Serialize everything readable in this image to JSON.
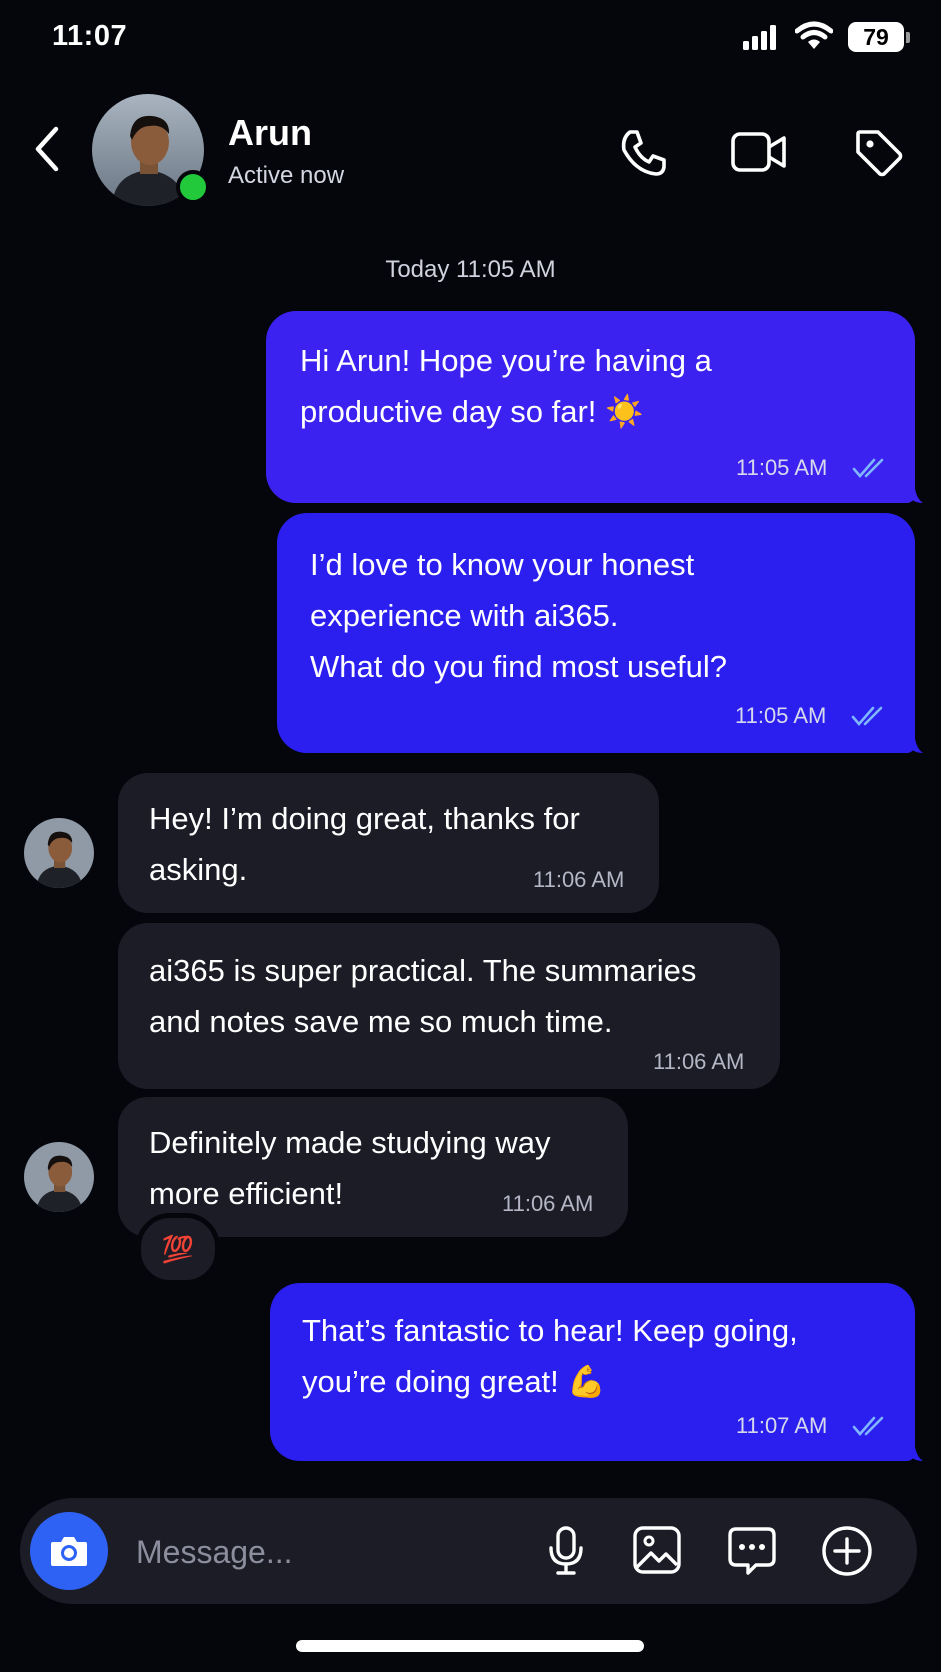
{
  "status_bar": {
    "time": "11:07",
    "battery": "79"
  },
  "header": {
    "contact_name": "Arun",
    "presence": "Active now",
    "online_color": "#22c93a"
  },
  "conversation": {
    "date_separator": "Today 11:05 AM",
    "messages": [
      {
        "direction": "outgoing",
        "text": "Hi Arun! Hope you’re having a\nproductive day so far! ☀️",
        "time": "11:05 AM",
        "read": true
      },
      {
        "direction": "outgoing",
        "text": "I’d love to know your honest\nexperience with ai365.\nWhat do you find most useful?",
        "time": "11:05 AM",
        "read": true
      },
      {
        "direction": "incoming",
        "text": "Hey! I’m doing great, thanks for\nasking.",
        "time": "11:06 AM"
      },
      {
        "direction": "incoming",
        "text": "ai365 is super practical. The summaries\nand notes save me so much time.",
        "time": "11:06 AM"
      },
      {
        "direction": "incoming",
        "text": "Definitely made studying way\nmore efficient!",
        "time": "11:06 AM",
        "reaction": "💯"
      },
      {
        "direction": "outgoing",
        "text": "That’s fantastic to hear! Keep going,\nyou’re doing great! 💪",
        "time": "11:07 AM",
        "read": true
      }
    ]
  },
  "composer": {
    "placeholder": "Message...",
    "icons": [
      "camera-icon",
      "microphone-icon",
      "image-icon",
      "chat-dots-icon",
      "plus-circle-icon"
    ]
  },
  "colors": {
    "background": "#05060c",
    "outgoing_bubble": "#2b1ff0",
    "incoming_bubble": "#1b1c26",
    "read_ticks": "#7fb6ff",
    "camera_button": "#2e62f5"
  }
}
